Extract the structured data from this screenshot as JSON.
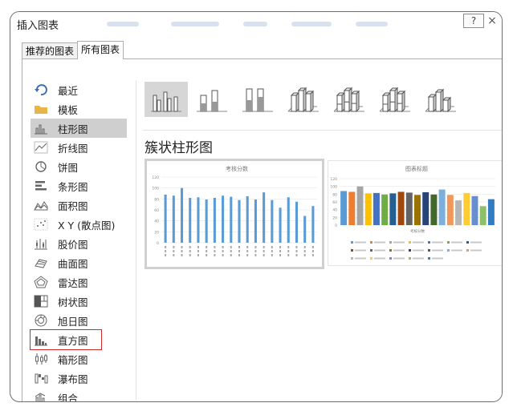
{
  "window": {
    "title": "插入图表",
    "help_label": "?",
    "close_label": "×"
  },
  "tabs": [
    {
      "label": "推荐的图表",
      "active": false
    },
    {
      "label": "所有图表",
      "active": true
    }
  ],
  "sidebar": {
    "items": [
      {
        "label": "最近",
        "icon": "recent-icon"
      },
      {
        "label": "模板",
        "icon": "folder-icon"
      },
      {
        "label": "柱形图",
        "icon": "column-chart-icon",
        "selected": true
      },
      {
        "label": "折线图",
        "icon": "line-chart-icon"
      },
      {
        "label": "饼图",
        "icon": "pie-chart-icon"
      },
      {
        "label": "条形图",
        "icon": "bar-chart-icon"
      },
      {
        "label": "面积图",
        "icon": "area-chart-icon"
      },
      {
        "label": "X Y (散点图)",
        "icon": "scatter-chart-icon"
      },
      {
        "label": "股价图",
        "icon": "stock-chart-icon"
      },
      {
        "label": "曲面图",
        "icon": "surface-chart-icon"
      },
      {
        "label": "雷达图",
        "icon": "radar-chart-icon"
      },
      {
        "label": "树状图",
        "icon": "treemap-chart-icon"
      },
      {
        "label": "旭日图",
        "icon": "sunburst-chart-icon"
      },
      {
        "label": "直方图",
        "icon": "histogram-chart-icon",
        "outlined": true
      },
      {
        "label": "箱形图",
        "icon": "box-whisker-chart-icon"
      },
      {
        "label": "瀑布图",
        "icon": "waterfall-chart-icon"
      },
      {
        "label": "组合",
        "icon": "combo-chart-icon"
      }
    ]
  },
  "subtypes": [
    {
      "icon": "clustered-column-icon",
      "selected": true
    },
    {
      "icon": "stacked-column-icon"
    },
    {
      "icon": "100-stacked-column-icon"
    },
    {
      "icon": "3d-clustered-column-icon"
    },
    {
      "icon": "3d-stacked-column-icon"
    },
    {
      "icon": "3d-100-stacked-column-icon"
    },
    {
      "icon": "3d-column-icon"
    }
  ],
  "main": {
    "section_title": "簇状柱形图"
  },
  "colors": {
    "bar_blue": "#5b9bd5",
    "selected_bg": "#cfcfcf",
    "highlight_red": "#cc2a2a"
  },
  "chart_data": [
    {
      "type": "bar",
      "title": "考核分数",
      "ylim": [
        0,
        120
      ],
      "yticks": [
        "120",
        "100",
        "80",
        "60",
        "40",
        "20",
        "0"
      ],
      "values": [
        88,
        86,
        100,
        82,
        83,
        79,
        82,
        86,
        84,
        78,
        85,
        79,
        92,
        78,
        64,
        83,
        75,
        49,
        67
      ]
    },
    {
      "type": "bar",
      "title": "图表标题",
      "xlabel": "考核分数",
      "ylim": [
        0,
        120
      ],
      "yticks": [
        "120",
        "100",
        "80",
        "60",
        "40",
        "20",
        "0"
      ],
      "values": [
        88,
        86,
        100,
        82,
        83,
        79,
        82,
        86,
        84,
        78,
        85,
        79,
        92,
        78,
        64,
        83,
        75,
        49,
        67
      ],
      "colors": [
        "#5b9bd5",
        "#ed7d31",
        "#a5a5a5",
        "#ffc000",
        "#4472c4",
        "#70ad47",
        "#255e91",
        "#9e480e",
        "#636363",
        "#997300",
        "#264478",
        "#43682b",
        "#7cafdd",
        "#f1975a",
        "#b7b7b7",
        "#ffcd33",
        "#698ed0",
        "#8cc168",
        "#327dc2"
      ]
    }
  ]
}
